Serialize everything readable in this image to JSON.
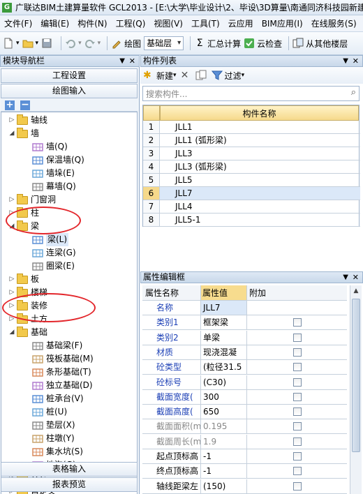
{
  "window": {
    "title": "广联达BIM土建算量软件 GCL2013 - [E:\\大学\\毕业设计\\2、毕设\\3D算量\\南通同济科技园新建"
  },
  "menu": [
    "文件(F)",
    "编辑(E)",
    "构件(N)",
    "工程(Q)",
    "视图(V)",
    "工具(T)",
    "云应用",
    "BIM应用(I)",
    "在线服务(S)",
    "帮"
  ],
  "toolbar": {
    "draw_label": "绘图",
    "floor_value": "基础层",
    "summary_label": "汇总计算",
    "cloud_check_label": "云检查",
    "copy_from_label": "从其他楼层"
  },
  "left_panel": {
    "title": "模块导航栏",
    "project_settings": "工程设置",
    "drawing_input": "绘图输入",
    "table_input": "表格输入",
    "report_preview": "报表预览",
    "tree": [
      {
        "label": "轴线",
        "level": 0,
        "type": "folder",
        "expanded": false
      },
      {
        "label": "墙",
        "level": 0,
        "type": "folder",
        "expanded": true
      },
      {
        "label": "墙(Q)",
        "level": 1,
        "type": "leaf",
        "icon": "wall-icon"
      },
      {
        "label": "保温墙(Q)",
        "level": 1,
        "type": "leaf",
        "icon": "insulation-wall-icon"
      },
      {
        "label": "墙垛(E)",
        "level": 1,
        "type": "leaf",
        "icon": "wall-pier-icon"
      },
      {
        "label": "幕墙(Q)",
        "level": 1,
        "type": "leaf",
        "icon": "curtain-wall-icon"
      },
      {
        "label": "门窗洞",
        "level": 0,
        "type": "folder",
        "expanded": false
      },
      {
        "label": "柱",
        "level": 0,
        "type": "folder",
        "expanded": false
      },
      {
        "label": "梁",
        "level": 0,
        "type": "folder",
        "expanded": true
      },
      {
        "label": "梁(L)",
        "level": 1,
        "type": "leaf",
        "icon": "beam-icon",
        "selected": true
      },
      {
        "label": "连梁(G)",
        "level": 1,
        "type": "leaf",
        "icon": "coupling-beam-icon"
      },
      {
        "label": "圈梁(E)",
        "level": 1,
        "type": "leaf",
        "icon": "ring-beam-icon"
      },
      {
        "label": "板",
        "level": 0,
        "type": "folder",
        "expanded": false
      },
      {
        "label": "楼梯",
        "level": 0,
        "type": "folder",
        "expanded": false
      },
      {
        "label": "装修",
        "level": 0,
        "type": "folder",
        "expanded": false
      },
      {
        "label": "土方",
        "level": 0,
        "type": "folder",
        "expanded": false
      },
      {
        "label": "基础",
        "level": 0,
        "type": "folder",
        "expanded": true
      },
      {
        "label": "基础梁(F)",
        "level": 1,
        "type": "leaf",
        "icon": "foundation-beam-icon"
      },
      {
        "label": "筏板基础(M)",
        "level": 1,
        "type": "leaf",
        "icon": "raft-foundation-icon"
      },
      {
        "label": "条形基础(T)",
        "level": 1,
        "type": "leaf",
        "icon": "strip-foundation-icon"
      },
      {
        "label": "独立基础(D)",
        "level": 1,
        "type": "leaf",
        "icon": "isolated-foundation-icon"
      },
      {
        "label": "桩承台(V)",
        "level": 1,
        "type": "leaf",
        "icon": "pile-cap-icon"
      },
      {
        "label": "桩(U)",
        "level": 1,
        "type": "leaf",
        "icon": "pile-icon"
      },
      {
        "label": "垫层(X)",
        "level": 1,
        "type": "leaf",
        "icon": "cushion-icon"
      },
      {
        "label": "柱墩(Y)",
        "level": 1,
        "type": "leaf",
        "icon": "column-pier-icon"
      },
      {
        "label": "集水坑(S)",
        "level": 1,
        "type": "leaf",
        "icon": "sump-icon"
      },
      {
        "label": "地沟(G)",
        "level": 1,
        "type": "leaf",
        "icon": "trench-icon"
      },
      {
        "label": "其它",
        "level": 0,
        "type": "folder",
        "expanded": false
      },
      {
        "label": "自定义",
        "level": 0,
        "type": "folder",
        "expanded": false
      }
    ]
  },
  "component_list": {
    "title": "构件列表",
    "new_label": "新建",
    "filter_label": "过滤",
    "search_placeholder": "搜索构件...",
    "column_header": "构件名称",
    "rows": [
      {
        "num": "1",
        "name": "JLL1"
      },
      {
        "num": "2",
        "name": "JLL1 (弧形梁)"
      },
      {
        "num": "3",
        "name": "JLL3"
      },
      {
        "num": "4",
        "name": "JLL3 (弧形梁)"
      },
      {
        "num": "5",
        "name": "JLL5"
      },
      {
        "num": "6",
        "name": "JLL7"
      },
      {
        "num": "7",
        "name": "JLL4"
      },
      {
        "num": "8",
        "name": "JLL5-1"
      }
    ],
    "selected_row": "6"
  },
  "property_editor": {
    "title": "属性编辑框",
    "headers": {
      "name": "属性名称",
      "value": "属性值",
      "add": "附加"
    },
    "rows": [
      {
        "num": "1",
        "name": "名称",
        "value": "JLL7",
        "style": "blue",
        "checkbox": false
      },
      {
        "num": "2",
        "name": "类别1",
        "value": "框架梁",
        "style": "blue",
        "checkbox": true
      },
      {
        "num": "3",
        "name": "类别2",
        "value": "单梁",
        "style": "blue",
        "checkbox": true
      },
      {
        "num": "4",
        "name": "材质",
        "value": "现浇混凝",
        "style": "blue",
        "checkbox": true
      },
      {
        "num": "5",
        "name": "砼类型",
        "value": "(粒径31.5",
        "style": "blue",
        "checkbox": true
      },
      {
        "num": "6",
        "name": "砼标号",
        "value": "(C30)",
        "style": "blue",
        "checkbox": true
      },
      {
        "num": "7",
        "name": "截面宽度(",
        "value": "300",
        "style": "blue",
        "checkbox": true
      },
      {
        "num": "8",
        "name": "截面高度(",
        "value": "650",
        "style": "blue",
        "checkbox": true
      },
      {
        "num": "9",
        "name": "截面面积(m",
        "value": "0.195",
        "style": "grey",
        "checkbox": true
      },
      {
        "num": "10",
        "name": "截面周长(m",
        "value": "1.9",
        "style": "grey",
        "checkbox": true
      },
      {
        "num": "11",
        "name": "起点顶标高",
        "value": "-1",
        "style": "normal",
        "checkbox": true
      },
      {
        "num": "12",
        "name": "终点顶标高",
        "value": "-1",
        "style": "normal",
        "checkbox": true
      },
      {
        "num": "13",
        "name": "轴线距梁左",
        "value": "(150)",
        "style": "normal",
        "checkbox": true
      }
    ]
  }
}
